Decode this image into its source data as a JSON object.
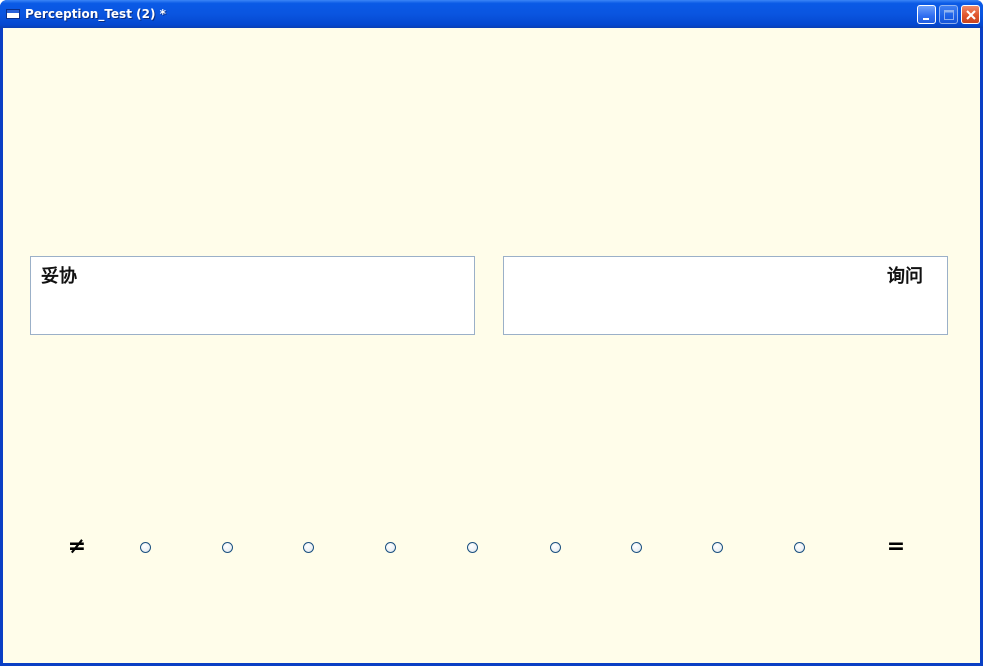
{
  "window": {
    "title": "Perception_Test (2) *",
    "controls": [
      "minimize",
      "maximize",
      "close"
    ]
  },
  "stimuli": {
    "left_word": "妥协",
    "right_word": "询问"
  },
  "scale": {
    "left_label": "≠",
    "right_label": "=",
    "options": [
      1,
      2,
      3,
      4,
      5,
      6,
      7,
      8,
      9
    ],
    "selected": null
  },
  "colors": {
    "client_background": "#fffdea",
    "titlebar": "#0a55e0",
    "textbox_border": "#9bb0c8",
    "radio_border": "#1c5180"
  }
}
